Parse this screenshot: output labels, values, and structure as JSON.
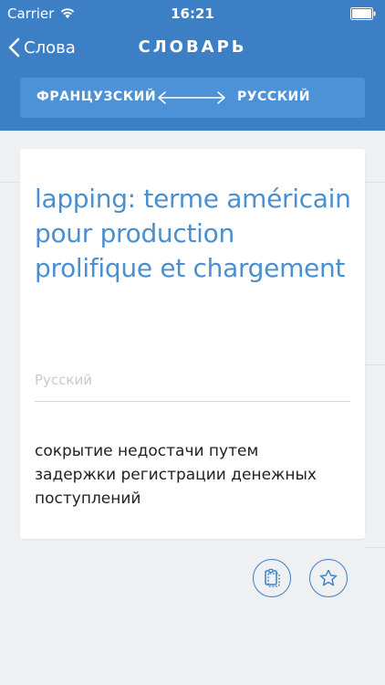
{
  "status_bar": {
    "carrier": "Carrier",
    "time": "16:21"
  },
  "nav": {
    "back_label": "Слова",
    "title": "СЛОВАРЬ"
  },
  "language_switch": {
    "from": "ФРАНЦУЗСКИЙ",
    "to": "РУССКИЙ"
  },
  "entry": {
    "term": "lapping: terme américain pour production prolifique et chargement",
    "target_language_label": "Русский",
    "translation": "сокрытие недостачи путем задержки регистрации денежных поступлений"
  },
  "actions": {
    "copy_icon": "copy-icon",
    "favorite_icon": "star-icon"
  },
  "colors": {
    "accent": "#3d7fc4",
    "header_bg": "#3d7fc4",
    "switch_bg": "#4d92d6",
    "term_text": "#4a8fd0",
    "page_bg": "#eef0f2"
  }
}
